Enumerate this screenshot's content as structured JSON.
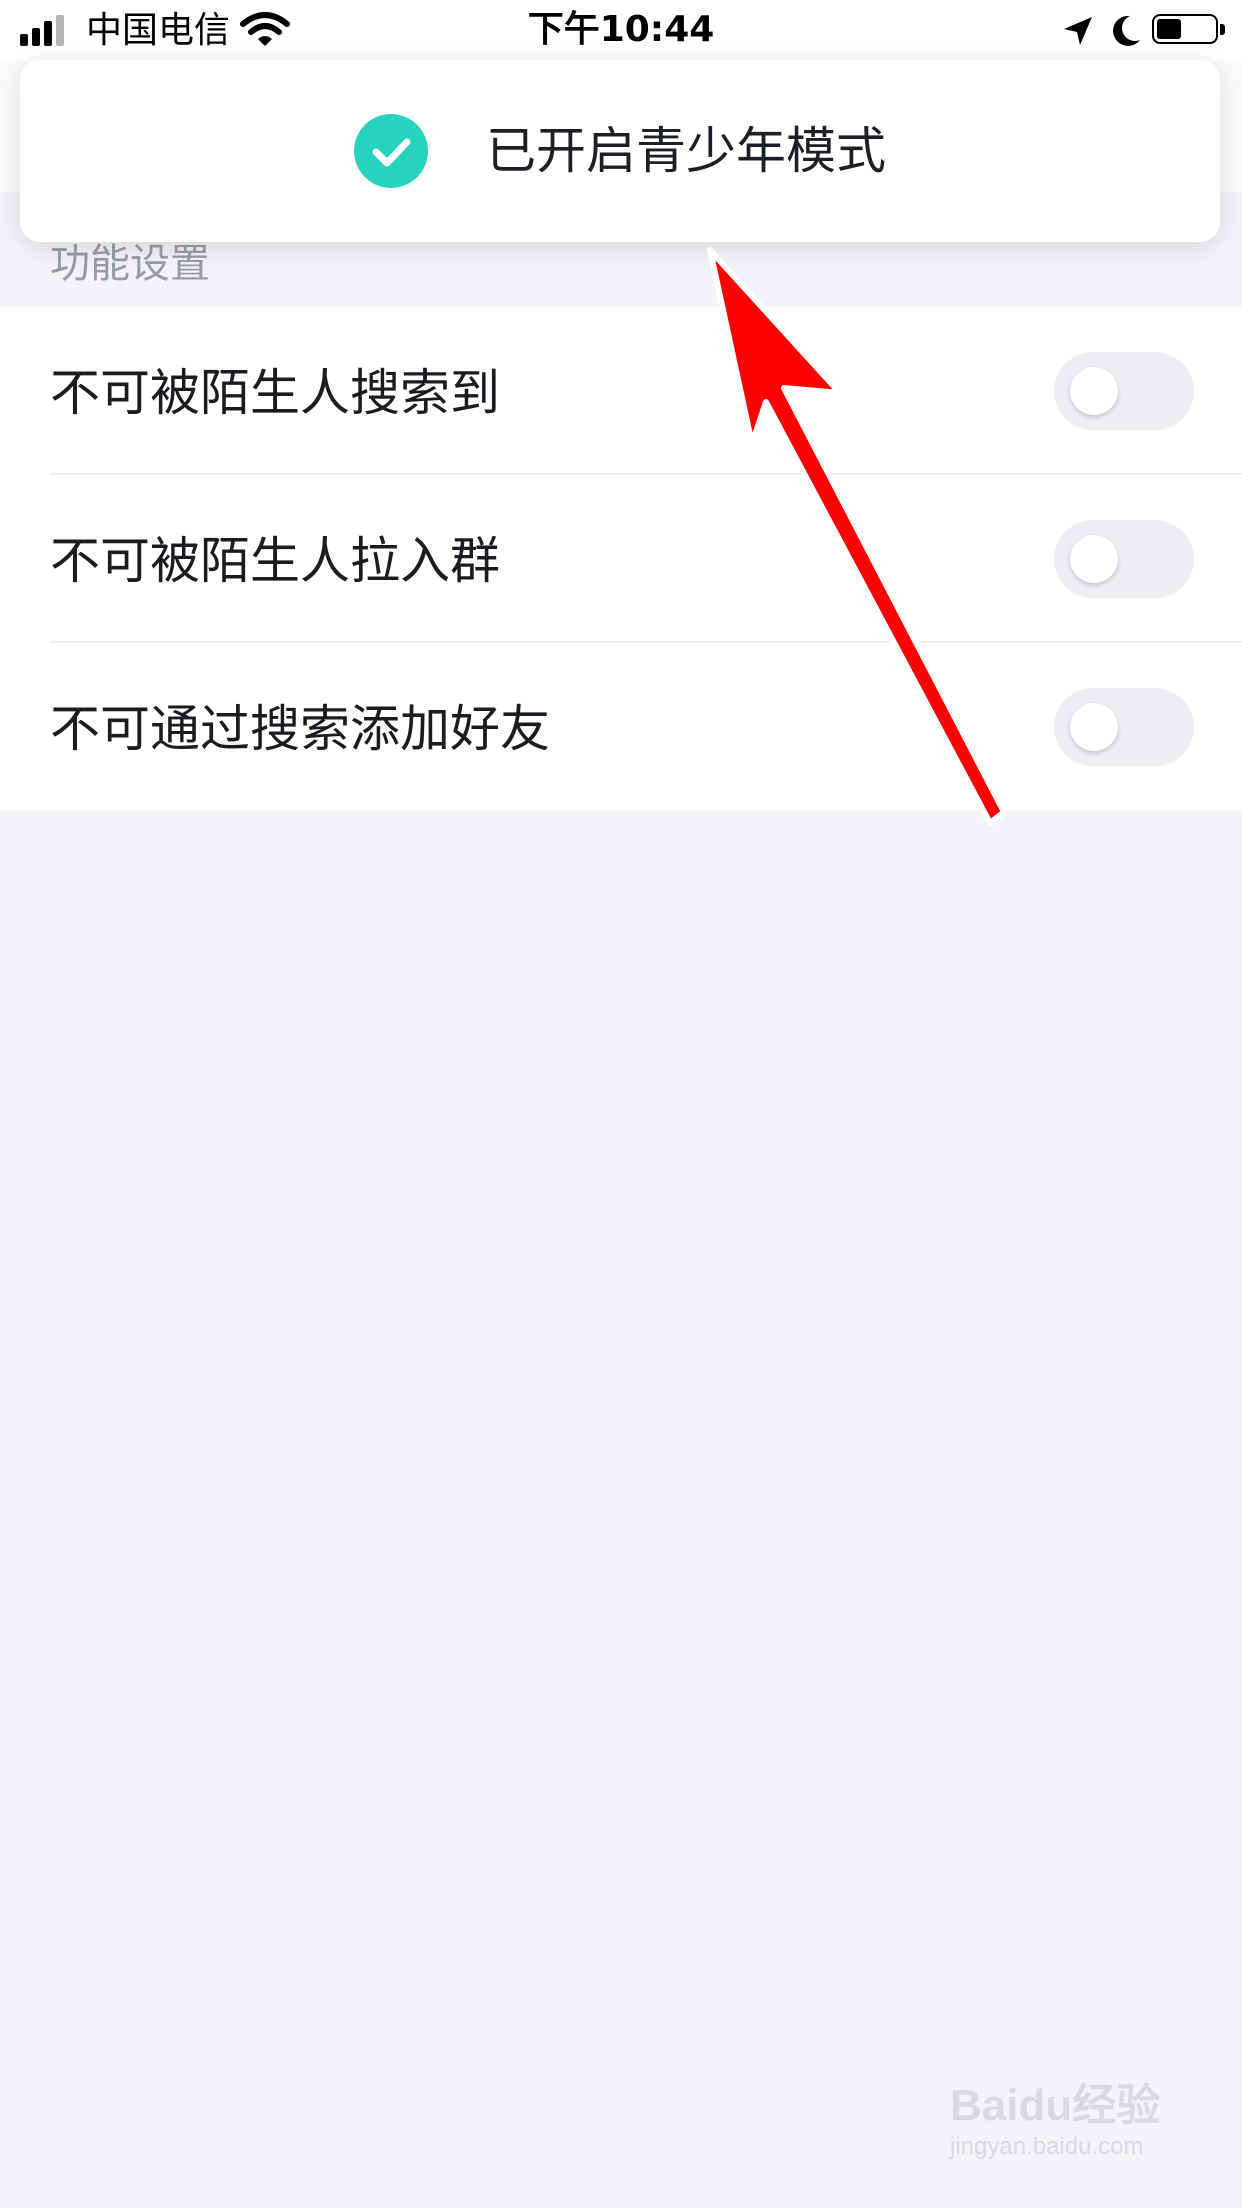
{
  "status_bar": {
    "carrier": "中国电信",
    "time": "下午10:44",
    "icons": [
      "signal-icon",
      "wifi-icon",
      "location-icon",
      "moon-icon",
      "battery-icon"
    ]
  },
  "toast": {
    "icon": "check-icon",
    "message": "已开启青少年模式",
    "accent_color": "#27d3bd"
  },
  "section": {
    "header": "功能设置"
  },
  "settings": [
    {
      "label": "不可被陌生人搜索到",
      "enabled": false
    },
    {
      "label": "不可被陌生人拉入群",
      "enabled": false
    },
    {
      "label": "不可通过搜索添加好友",
      "enabled": false
    }
  ],
  "annotation": {
    "arrow_color": "#ff0000"
  },
  "watermark": {
    "logo": "Baidu经验",
    "url": "jingyan.baidu.com"
  }
}
